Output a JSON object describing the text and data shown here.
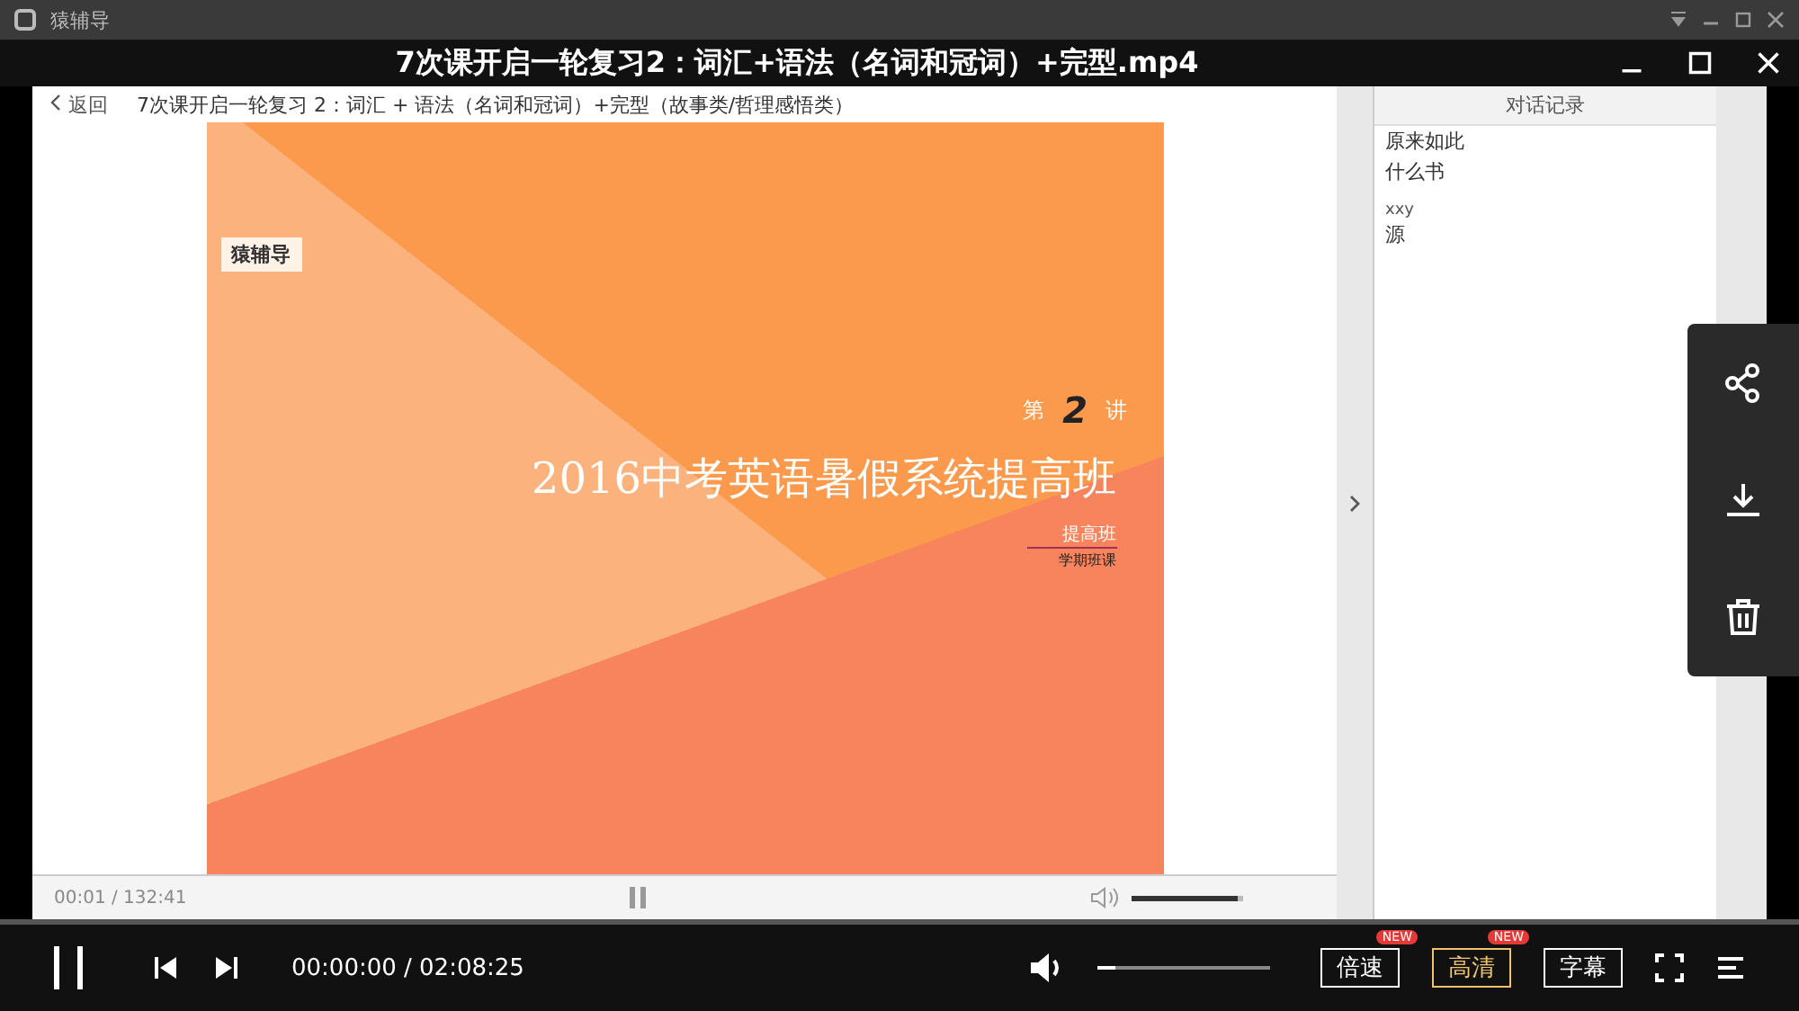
{
  "app_window": {
    "title": "猿辅导"
  },
  "player_title": "7次课开启一轮复习2：词汇+语法（名词和冠词）+完型.mp4",
  "lesson": {
    "back": "返回",
    "title": "7次课开启一轮复习 2：词汇 + 语法（名词和冠词）+完型（故事类/哲理感悟类）"
  },
  "slide": {
    "badge": "猿辅导",
    "lecture_prefix": "第",
    "lecture_number": "2",
    "lecture_suffix": "讲",
    "headline": "2016中考英语暑假系统提高班",
    "level_tag": "提高班",
    "term": "学期班课"
  },
  "chat": {
    "title": "对话记录",
    "messages": [
      {
        "kind": "text",
        "text": "原来如此"
      },
      {
        "kind": "text",
        "text": "什么书"
      },
      {
        "kind": "sender",
        "text": "xxy"
      },
      {
        "kind": "text",
        "text": "源"
      }
    ]
  },
  "inner_controls": {
    "time": "00:01 / 132:41",
    "volume": {
      "level": 0.95
    }
  },
  "controls": {
    "progress": {
      "level": 0
    },
    "time": "00:00:00 / 02:08:25",
    "volume": {
      "level": 0.1
    },
    "options": [
      {
        "label": "倍速",
        "badge": "NEW",
        "selected": false
      },
      {
        "label": "高清",
        "badge": "NEW",
        "selected": true
      },
      {
        "label": "字幕",
        "selected": false
      }
    ]
  }
}
